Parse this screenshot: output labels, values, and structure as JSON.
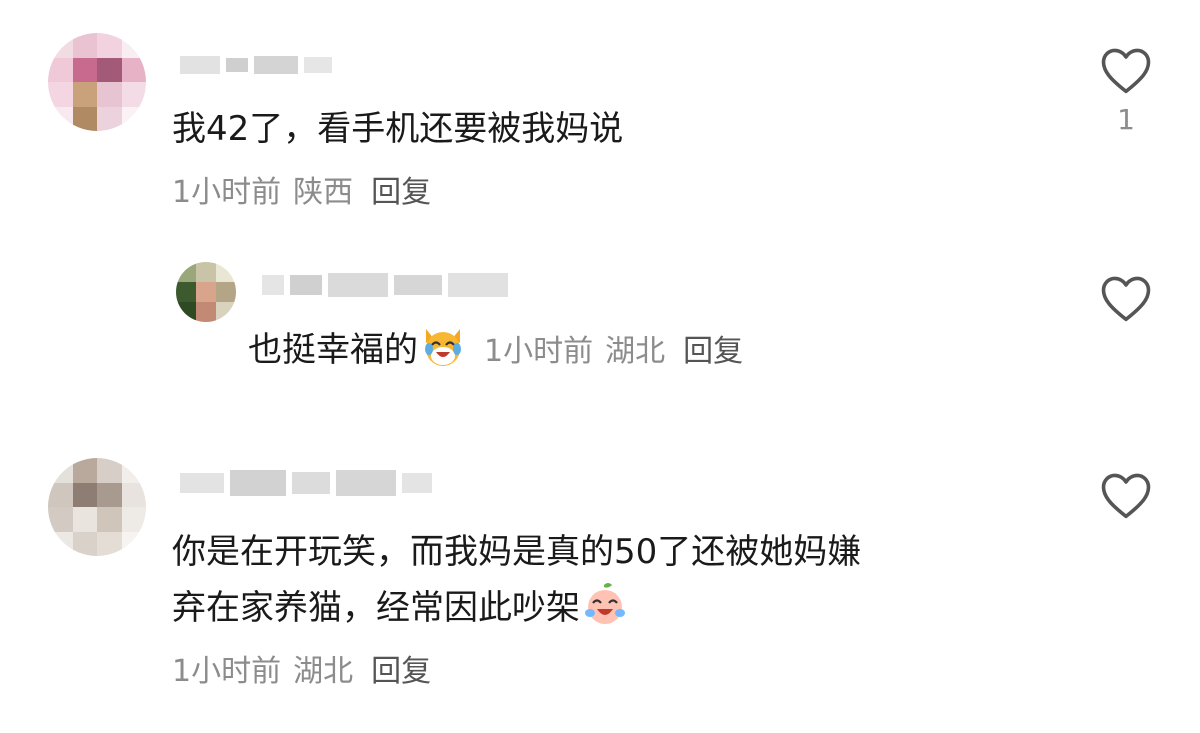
{
  "comments": [
    {
      "text": "我42了，看手机还要被我妈说",
      "time": "1小时前",
      "location": "陕西",
      "reply_label": "回复",
      "likes": "1",
      "like_icon": "heart-outline-icon"
    },
    {
      "text": "也挺幸福的",
      "emoji": "laughing-cat-emoji",
      "time": "1小时前",
      "location": "湖北",
      "reply_label": "回复",
      "like_icon": "heart-outline-icon"
    },
    {
      "text_line1": "你是在开玩笑，而我妈是真的50了还被她妈嫌",
      "text_line2": "弃在家养猫，经常因此吵架",
      "emoji": "crying-laughing-peach-emoji",
      "time": "1小时前",
      "location": "湖北",
      "reply_label": "回复",
      "like_icon": "heart-outline-icon"
    }
  ],
  "colors": {
    "text": "#1a1a1a",
    "meta": "#8c8c8c",
    "icon": "#555555"
  }
}
